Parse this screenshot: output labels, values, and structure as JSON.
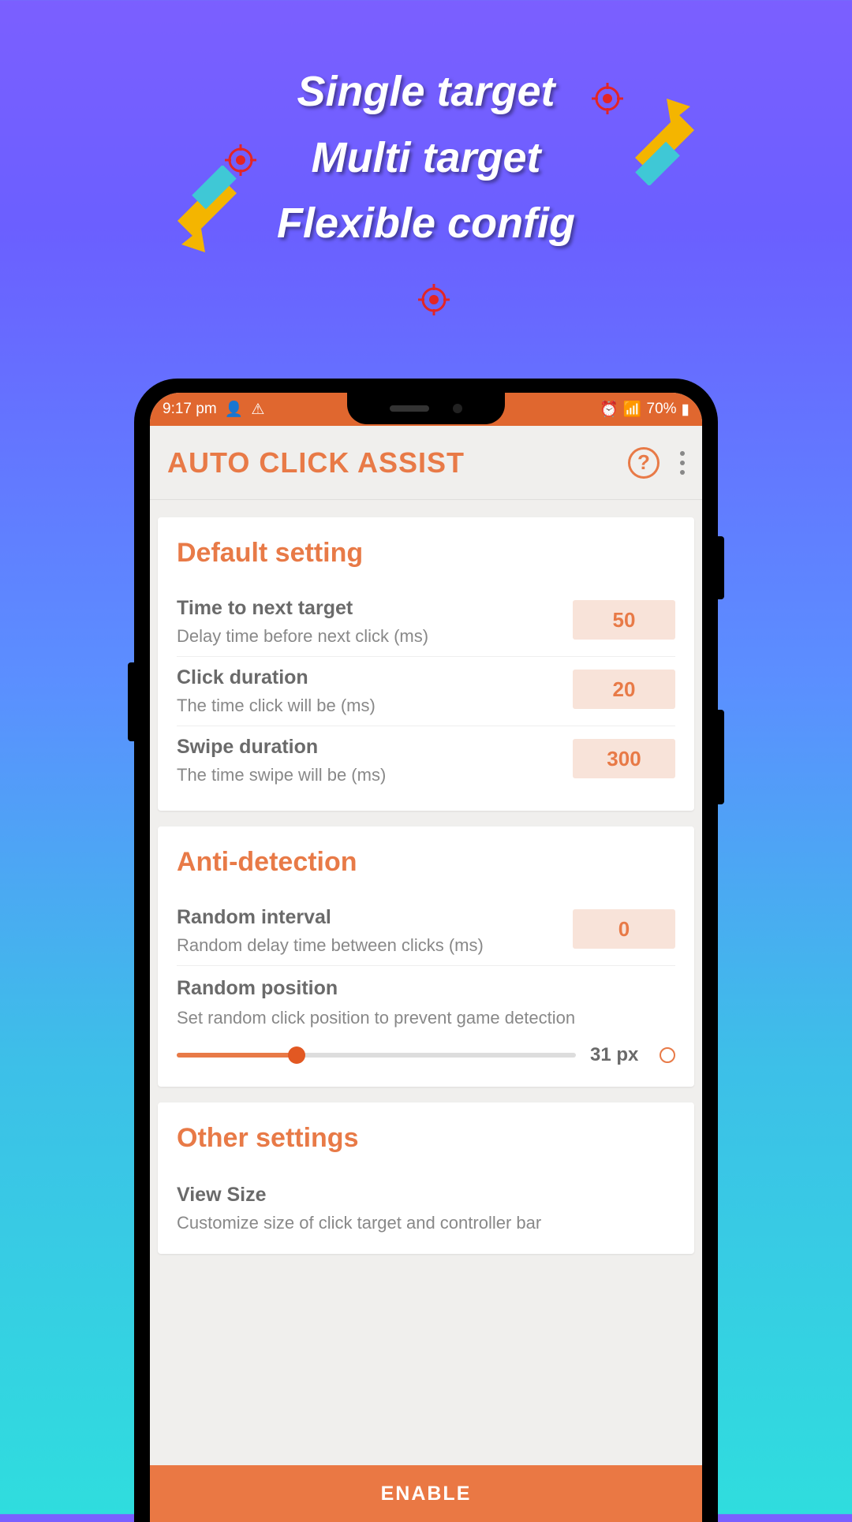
{
  "promo": {
    "line1": "Single target",
    "line2": "Multi target",
    "line3": "Flexible config"
  },
  "status": {
    "time": "9:17 pm",
    "battery": "70%"
  },
  "header": {
    "title": "AUTO CLICK ASSIST"
  },
  "sections": {
    "default": {
      "title": "Default setting",
      "items": [
        {
          "label": "Time to next target",
          "desc": "Delay time before next click (ms)",
          "value": "50"
        },
        {
          "label": "Click duration",
          "desc": "The time click will be (ms)",
          "value": "20"
        },
        {
          "label": "Swipe duration",
          "desc": "The time swipe will be (ms)",
          "value": "300"
        }
      ]
    },
    "anti": {
      "title": "Anti-detection",
      "random_interval": {
        "label": "Random interval",
        "desc": "Random delay time between clicks (ms)",
        "value": "0"
      },
      "random_position": {
        "label": "Random position",
        "desc": "Set random click position to prevent game detection",
        "value": "31 px"
      }
    },
    "other": {
      "title": "Other settings",
      "view_size": {
        "label": "View Size",
        "desc": "Customize size of click target and controller bar"
      }
    }
  },
  "button": {
    "enable": "ENABLE"
  }
}
